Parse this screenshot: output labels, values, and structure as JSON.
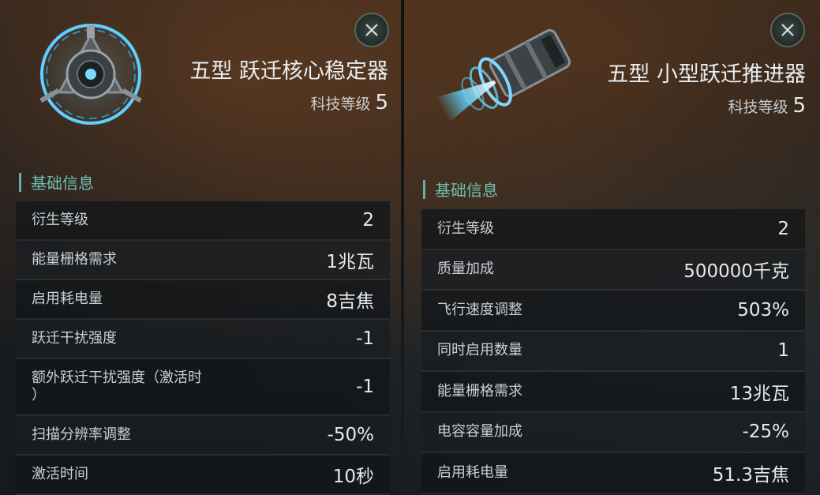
{
  "left": {
    "title": "五型 跃迁核心稳定器",
    "tech_label": "科技等级",
    "tech_value": "5",
    "section": "基础信息",
    "rows": [
      {
        "label": "衍生等级",
        "value": "2"
      },
      {
        "label": "能量栅格需求",
        "value": "1兆瓦"
      },
      {
        "label": "启用耗电量",
        "value": "8吉焦"
      },
      {
        "label": "跃迁干扰强度",
        "value": "-1"
      },
      {
        "label": "额外跃迁干扰强度（激活时\n）",
        "value": "-1"
      },
      {
        "label": "扫描分辨率调整",
        "value": "-50%"
      },
      {
        "label": "激活时间",
        "value": "10秒"
      }
    ]
  },
  "right": {
    "title": "五型 小型跃迁推进器",
    "tech_label": "科技等级",
    "tech_value": "5",
    "section": "基础信息",
    "rows": [
      {
        "label": "衍生等级",
        "value": "2"
      },
      {
        "label": "质量加成",
        "value": "500000千克"
      },
      {
        "label": "飞行速度调整",
        "value": "503%"
      },
      {
        "label": "同时启用数量",
        "value": "1"
      },
      {
        "label": "能量栅格需求",
        "value": "13兆瓦"
      },
      {
        "label": "电容容量加成",
        "value": "-25%"
      },
      {
        "label": "启用耗电量",
        "value": "51.3吉焦"
      }
    ]
  },
  "icons": {
    "close": "close-x-icon",
    "left_item": "warp-core-stabilizer-icon",
    "right_item": "warp-thruster-icon"
  },
  "colors": {
    "accent": "#6fc0b2",
    "icon_glow": "#5fd0ff"
  }
}
